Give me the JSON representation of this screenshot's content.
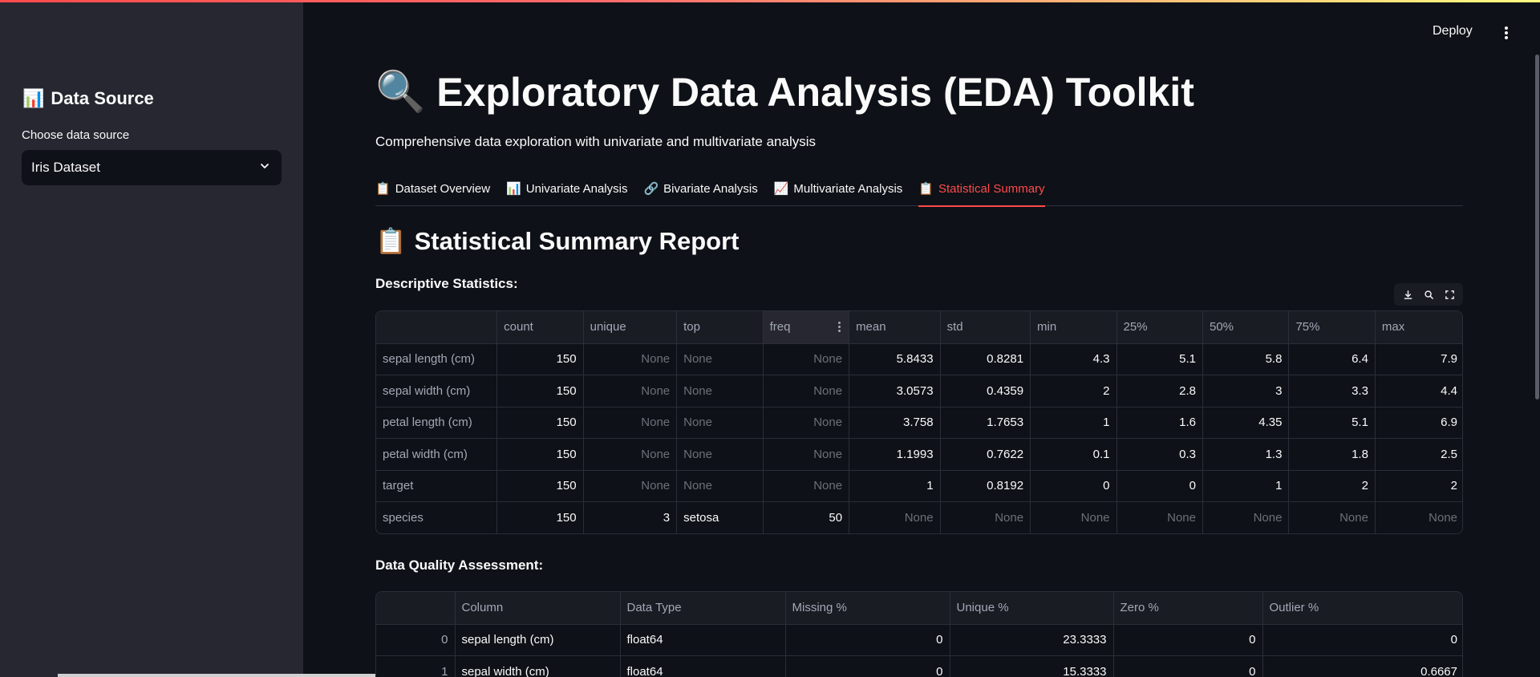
{
  "header": {
    "deploy_label": "Deploy"
  },
  "sidebar": {
    "title_icon": "📊",
    "title": "Data Source",
    "select_label": "Choose data source",
    "select_value": "Iris Dataset"
  },
  "page": {
    "title_icon": "🔍",
    "title": "Exploratory Data Analysis (EDA) Toolkit",
    "subtitle": "Comprehensive data exploration with univariate and multivariate analysis"
  },
  "tabs": [
    {
      "icon": "📋",
      "label": "Dataset Overview"
    },
    {
      "icon": "📊",
      "label": "Univariate Analysis"
    },
    {
      "icon": "🔗",
      "label": "Bivariate Analysis"
    },
    {
      "icon": "📈",
      "label": "Multivariate Analysis"
    },
    {
      "icon": "📋",
      "label": "Statistical Summary"
    }
  ],
  "active_tab": 4,
  "report": {
    "title_icon": "📋",
    "title": "Statistical Summary Report",
    "descriptive_heading": "Descriptive Statistics:",
    "quality_heading": "Data Quality Assessment:"
  },
  "descriptive": {
    "columns": [
      "",
      "count",
      "unique",
      "top",
      "freq",
      "mean",
      "std",
      "min",
      "25%",
      "50%",
      "75%",
      "max"
    ],
    "rows": [
      [
        "sepal length (cm)",
        "150",
        "None",
        "None",
        "None",
        "5.8433",
        "0.8281",
        "4.3",
        "5.1",
        "5.8",
        "6.4",
        "7.9"
      ],
      [
        "sepal width (cm)",
        "150",
        "None",
        "None",
        "None",
        "3.0573",
        "0.4359",
        "2",
        "2.8",
        "3",
        "3.3",
        "4.4"
      ],
      [
        "petal length (cm)",
        "150",
        "None",
        "None",
        "None",
        "3.758",
        "1.7653",
        "1",
        "1.6",
        "4.35",
        "5.1",
        "6.9"
      ],
      [
        "petal width (cm)",
        "150",
        "None",
        "None",
        "None",
        "1.1993",
        "0.7622",
        "0.1",
        "0.3",
        "1.3",
        "1.8",
        "2.5"
      ],
      [
        "target",
        "150",
        "None",
        "None",
        "None",
        "1",
        "0.8192",
        "0",
        "0",
        "1",
        "2",
        "2"
      ],
      [
        "species",
        "150",
        "3",
        "setosa",
        "50",
        "None",
        "None",
        "None",
        "None",
        "None",
        "None",
        "None"
      ]
    ]
  },
  "quality": {
    "columns": [
      "",
      "Column",
      "Data Type",
      "Missing %",
      "Unique %",
      "Zero %",
      "Outlier %"
    ],
    "rows": [
      [
        "0",
        "sepal length (cm)",
        "float64",
        "0",
        "23.3333",
        "0",
        "0"
      ],
      [
        "1",
        "sepal width (cm)",
        "float64",
        "0",
        "15.3333",
        "0",
        "0.6667"
      ]
    ]
  },
  "icons": {
    "select_chevron": "chevron-down-icon",
    "kebab": "more-vertical-icon",
    "download": "download-icon",
    "search": "search-icon",
    "fullscreen": "fullscreen-icon"
  },
  "colors": {
    "accent": "#ff4b4b",
    "background": "#0e1117",
    "sidebar": "#262730"
  }
}
